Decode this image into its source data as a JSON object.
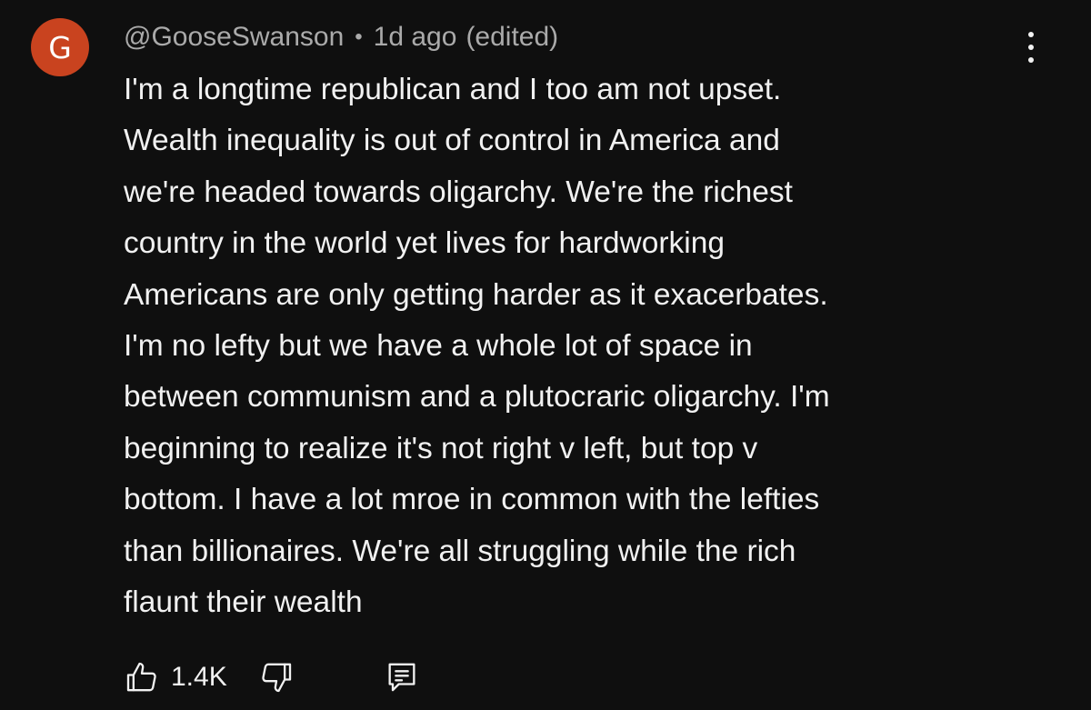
{
  "comment": {
    "avatar_letter": "G",
    "avatar_color": "#c9431f",
    "author": "@GooseSwanson",
    "separator": "•",
    "time": "1d ago",
    "edited": "(edited)",
    "lines": [
      "I'm a longtime republican and I too am not upset.",
      "Wealth inequality is out of control in America and",
      "we're headed towards oligarchy. We're the richest",
      "country in the world yet lives for hardworking",
      "Americans are only getting harder as it exacerbates.",
      "I'm no lefty but we have a whole lot of space in",
      "between communism and a plutocraric oligarchy. I'm",
      "beginning to realize it's not right v left, but top v",
      "bottom. I have a lot mroe in common with the lefties",
      "than billionaires. We're all struggling while the rich",
      "flaunt their wealth"
    ],
    "like_count": "1.4K",
    "icons": {
      "more": "more-vert-icon",
      "like": "thumbs-up-icon",
      "dislike": "thumbs-down-icon",
      "reply": "comment-icon"
    }
  }
}
